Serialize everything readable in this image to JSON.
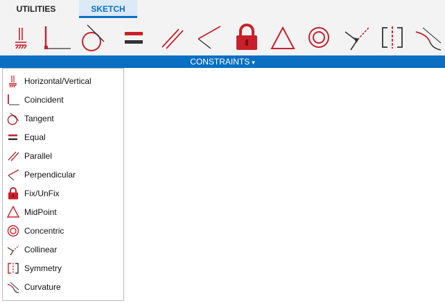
{
  "tabs": [
    {
      "label": "UTILITIES",
      "active": false
    },
    {
      "label": "SKETCH",
      "active": true
    }
  ],
  "panel": {
    "label": "CONSTRAINTS",
    "caret": "▾"
  },
  "ribbon_icons": [
    "horizontal-vertical-icon",
    "coincident-icon",
    "tangent-icon",
    "equal-icon",
    "parallel-icon",
    "perpendicular-icon",
    "fix-unfix-icon",
    "midpoint-icon",
    "concentric-icon",
    "collinear-icon",
    "symmetry-icon",
    "curvature-icon"
  ],
  "menu": {
    "items": [
      {
        "label": "Horizontal/Vertical",
        "icon": "horizontal-vertical-icon"
      },
      {
        "label": "Coincident",
        "icon": "coincident-icon"
      },
      {
        "label": "Tangent",
        "icon": "tangent-icon"
      },
      {
        "label": "Equal",
        "icon": "equal-icon"
      },
      {
        "label": "Parallel",
        "icon": "parallel-icon"
      },
      {
        "label": "Perpendicular",
        "icon": "perpendicular-icon"
      },
      {
        "label": "Fix/UnFix",
        "icon": "fix-unfix-icon"
      },
      {
        "label": "MidPoint",
        "icon": "midpoint-icon"
      },
      {
        "label": "Concentric",
        "icon": "concentric-icon"
      },
      {
        "label": "Collinear",
        "icon": "collinear-icon"
      },
      {
        "label": "Symmetry",
        "icon": "symmetry-icon"
      },
      {
        "label": "Curvature",
        "icon": "curvature-icon"
      }
    ]
  },
  "colors": {
    "accent": "#0a6fc2",
    "icon_red": "#c8202a",
    "toolbar_bg": "#f3f3f3"
  }
}
